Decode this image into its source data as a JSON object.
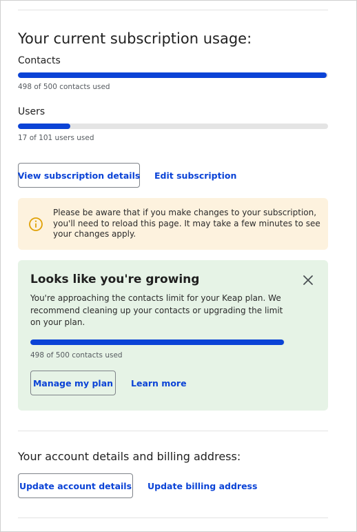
{
  "subscription_usage": {
    "title": "Your current subscription usage:",
    "contacts": {
      "label": "Contacts",
      "used": 498,
      "limit": 500,
      "caption": "498 of 500 contacts used"
    },
    "users": {
      "label": "Users",
      "used": 17,
      "limit": 101,
      "caption": "17 of 101 users used"
    },
    "view_details_label": "View subscription details",
    "edit_label": "Edit subscription"
  },
  "warning": {
    "icon": "info-circle-icon",
    "text": "Please be aware that if you make changes to your subscription, you'll need to reload this page. It may take a few minutes to see your changes apply."
  },
  "growth_card": {
    "title": "Looks like you're growing",
    "body": "You're approaching the contacts limit for your Keap plan. We recommend cleaning up your contacts or upgrading the limit on your plan.",
    "used": 498,
    "limit": 500,
    "caption": "498 of 500 contacts used",
    "manage_label": "Manage my plan",
    "learn_more_label": "Learn more",
    "close_icon": "close-icon"
  },
  "account": {
    "title": "Your account details and billing address:",
    "update_account_label": "Update account details",
    "update_billing_label": "Update billing address"
  },
  "colors": {
    "accent": "#0b43d6",
    "warning_bg": "#fdf2de",
    "warning_icon": "#e0a106",
    "growth_bg": "#e6f3e6"
  }
}
